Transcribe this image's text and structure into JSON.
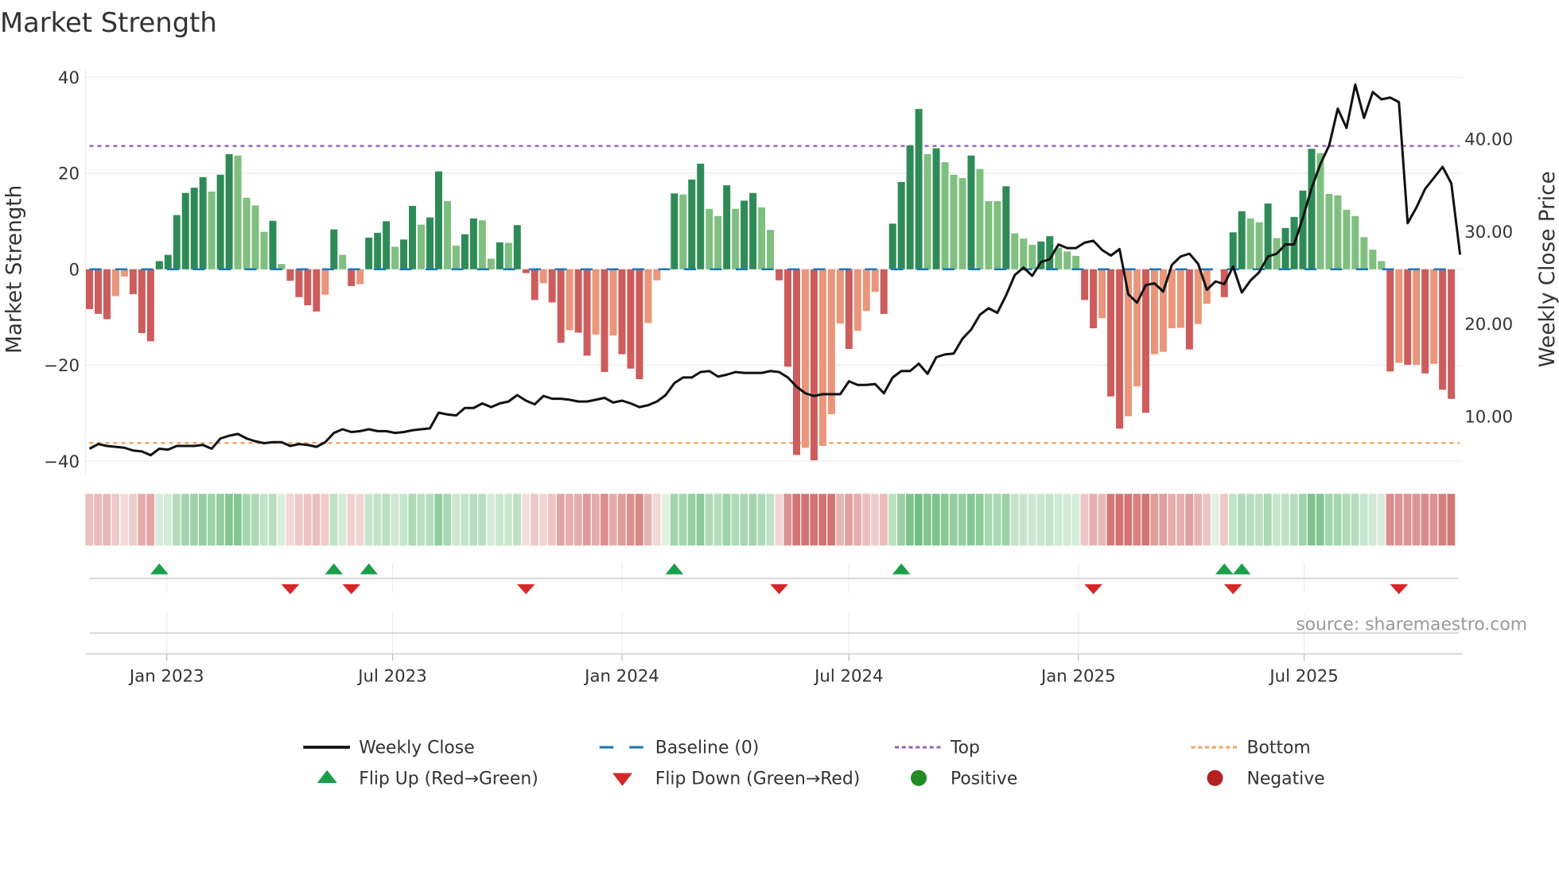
{
  "chart_data": {
    "type": "bar",
    "title": "Market Strength",
    "ylabel": "Market Strength",
    "y2label": "Weekly Close Price",
    "ylim": [
      -42,
      42
    ],
    "y2lim": [
      2.4,
      47.6
    ],
    "y_ticks": [
      40,
      20,
      0,
      -20,
      -40
    ],
    "y_tick_labels": [
      "40",
      "20",
      "0",
      "−20",
      "−40"
    ],
    "y2_ticks": [
      40,
      30,
      20,
      10
    ],
    "y2_tick_labels": [
      "40.00",
      "30.00",
      "20.00",
      "10.00"
    ],
    "start_week": "2022-10-31",
    "x_ticks": [
      {
        "date": "2023-01-01",
        "label": "Jan 2023"
      },
      {
        "date": "2023-07-01",
        "label": "Jul 2023"
      },
      {
        "date": "2024-01-01",
        "label": "Jan 2024"
      },
      {
        "date": "2024-07-01",
        "label": "Jul 2024"
      },
      {
        "date": "2025-01-01",
        "label": "Jan 2025"
      },
      {
        "date": "2025-07-01",
        "label": "Jul 2025"
      }
    ],
    "top_level": 25.7,
    "bottom_level": -36.2,
    "baseline": 0,
    "strength": [
      -8.3,
      -9.3,
      -10.4,
      -5.6,
      -1.5,
      -5.2,
      -13.3,
      -15,
      1.7,
      3,
      11.3,
      15.9,
      17,
      19.2,
      16.2,
      19.7,
      24,
      23.7,
      14.9,
      13.3,
      7.8,
      10.1,
      1.1,
      -2.4,
      -5.8,
      -7.5,
      -8.8,
      -5.3,
      8.3,
      3,
      -3.5,
      -3.1,
      6.6,
      7.6,
      10,
      4.7,
      6.2,
      13.2,
      9.3,
      10.8,
      20.4,
      14.2,
      4.9,
      7.3,
      10.6,
      10.2,
      2.2,
      5.6,
      5.5,
      9.2,
      -0.8,
      -6.4,
      -2.9,
      -6.9,
      -15.3,
      -12.7,
      -13.2,
      -18,
      -13.6,
      -21.4,
      -13.8,
      -17.7,
      -20.7,
      -22.9,
      -11.2,
      -2.3,
      0,
      15.8,
      15.6,
      18.7,
      22,
      12.6,
      11.1,
      17.5,
      12.6,
      14.3,
      15.9,
      12.9,
      8.2,
      -2.3,
      -20.3,
      -38.7,
      -37.2,
      -39.8,
      -36.8,
      -30.2,
      -11.3,
      -16.6,
      -12.8,
      -8.7,
      -4.7,
      -9.3,
      9.5,
      18.2,
      25.8,
      33.4,
      24,
      25.2,
      22.3,
      19.7,
      19,
      23.7,
      20.9,
      14.2,
      14.2,
      17.3,
      7.5,
      6.4,
      5.1,
      5.8,
      6.9,
      4.5,
      3.7,
      2.8,
      -6.4,
      -12.3,
      -10.2,
      -26.5,
      -33.2,
      -30.6,
      -24.4,
      -29.9,
      -17.7,
      -17.2,
      -12.3,
      -12.2,
      -16.7,
      -11.4,
      -7.2,
      0,
      -5.8,
      7.7,
      12.1,
      10.6,
      9.8,
      13.7,
      6.5,
      8.6,
      10.9,
      16.4,
      25.1,
      24.2,
      15.7,
      15.4,
      12.4,
      11.1,
      6.7,
      4.1,
      1.7,
      -21.3,
      -19.5,
      -19.9,
      -19.9,
      -21.7,
      -19.7,
      -25.1,
      -27
    ],
    "strong": [
      1,
      1,
      1,
      0,
      0,
      1,
      1,
      1,
      1,
      1,
      1,
      1,
      1,
      1,
      0,
      1,
      1,
      0,
      0,
      0,
      0,
      1,
      0,
      1,
      1,
      1,
      1,
      0,
      1,
      0,
      1,
      0,
      1,
      1,
      1,
      0,
      1,
      1,
      0,
      1,
      1,
      0,
      0,
      1,
      1,
      0,
      0,
      1,
      0,
      1,
      1,
      1,
      0,
      1,
      1,
      0,
      1,
      1,
      0,
      1,
      0,
      1,
      1,
      1,
      0,
      0,
      0,
      1,
      0,
      1,
      1,
      0,
      0,
      1,
      0,
      1,
      1,
      0,
      0,
      1,
      1,
      1,
      0,
      1,
      0,
      0,
      0,
      1,
      0,
      0,
      0,
      1,
      1,
      1,
      1,
      1,
      0,
      1,
      0,
      0,
      0,
      1,
      0,
      0,
      0,
      1,
      0,
      0,
      0,
      1,
      1,
      0,
      0,
      0,
      1,
      1,
      0,
      1,
      1,
      0,
      0,
      1,
      0,
      0,
      0,
      0,
      1,
      0,
      0,
      0,
      1,
      1,
      1,
      0,
      0,
      1,
      0,
      1,
      1,
      1,
      1,
      0,
      0,
      0,
      0,
      0,
      0,
      0,
      0,
      1,
      0,
      1,
      0,
      1,
      0,
      1,
      1
    ],
    "weekly_close": [
      6.5,
      7.0,
      6.8,
      6.7,
      6.6,
      6.3,
      6.2,
      5.8,
      6.5,
      6.4,
      6.8,
      6.8,
      6.8,
      6.9,
      6.5,
      7.6,
      7.9,
      8.1,
      7.6,
      7.3,
      7.1,
      7.2,
      7.2,
      6.8,
      7.0,
      6.9,
      6.7,
      7.2,
      8.2,
      8.6,
      8.3,
      8.4,
      8.6,
      8.4,
      8.4,
      8.2,
      8.3,
      8.5,
      8.6,
      8.7,
      10.4,
      10.2,
      10.1,
      10.9,
      10.9,
      11.4,
      11.0,
      11.4,
      11.6,
      12.3,
      11.7,
      11.3,
      12.2,
      11.9,
      11.9,
      11.8,
      11.6,
      11.6,
      11.8,
      12.0,
      11.5,
      11.7,
      11.4,
      11.0,
      11.2,
      11.6,
      12.3,
      13.6,
      14.2,
      14.2,
      14.8,
      14.9,
      14.3,
      14.5,
      14.8,
      14.7,
      14.7,
      14.7,
      14.9,
      14.8,
      14.2,
      13.2,
      12.5,
      12.2,
      12.4,
      12.4,
      12.4,
      13.8,
      13.4,
      13.4,
      13.5,
      12.5,
      14.2,
      14.9,
      14.9,
      15.7,
      14.6,
      16.4,
      16.7,
      16.8,
      18.4,
      19.4,
      21.0,
      21.7,
      21.2,
      23.1,
      25.3,
      26.1,
      25.2,
      26.7,
      27.0,
      28.6,
      28.2,
      28.2,
      28.8,
      29.0,
      28.0,
      27.4,
      28.1,
      23.2,
      22.3,
      24.2,
      24.4,
      23.5,
      26.4,
      27.3,
      27.6,
      26.5,
      23.7,
      24.6,
      24.3,
      26.2,
      23.4,
      24.7,
      25.6,
      27.3,
      27.6,
      28.6,
      28.6,
      31.5,
      34.7,
      37.3,
      39.3,
      43.3,
      41.2,
      45.9,
      42.3,
      45.1,
      44.3,
      44.5,
      44.0,
      30.9,
      32.6,
      34.6,
      35.8,
      37.0,
      35.2,
      27.5
    ],
    "flip_up_weeks": [
      8,
      28,
      32,
      67,
      93,
      130,
      132
    ],
    "flip_down_weeks": [
      23,
      30,
      50,
      79,
      115,
      131,
      150
    ],
    "legend": {
      "placement": "bottom",
      "items": [
        {
          "label": "Weekly Close",
          "kind": "line"
        },
        {
          "label": "Baseline (0)",
          "kind": "baseline"
        },
        {
          "label": "Top",
          "kind": "top"
        },
        {
          "label": "Bottom",
          "kind": "bottom"
        },
        {
          "label": "Flip Up (Red→Green)",
          "kind": "up"
        },
        {
          "label": "Flip Down (Green→Red)",
          "kind": "down"
        },
        {
          "label": "Positive",
          "kind": "pos"
        },
        {
          "label": "Negative",
          "kind": "neg"
        }
      ]
    },
    "watermark": "source: sharemaestro.com"
  },
  "colors": {
    "strong_pos": "#2e8b57",
    "weak_pos": "#7fbf7f",
    "strong_neg": "#cd5c5c",
    "weak_neg": "#e9967a",
    "baseline": "#1f77b4",
    "top": "#9467bd",
    "bottom": "#f4a460",
    "flip_up": "#1a9e4a",
    "flip_down": "#d62728",
    "positive": "#228b22",
    "negative": "#b22222"
  }
}
